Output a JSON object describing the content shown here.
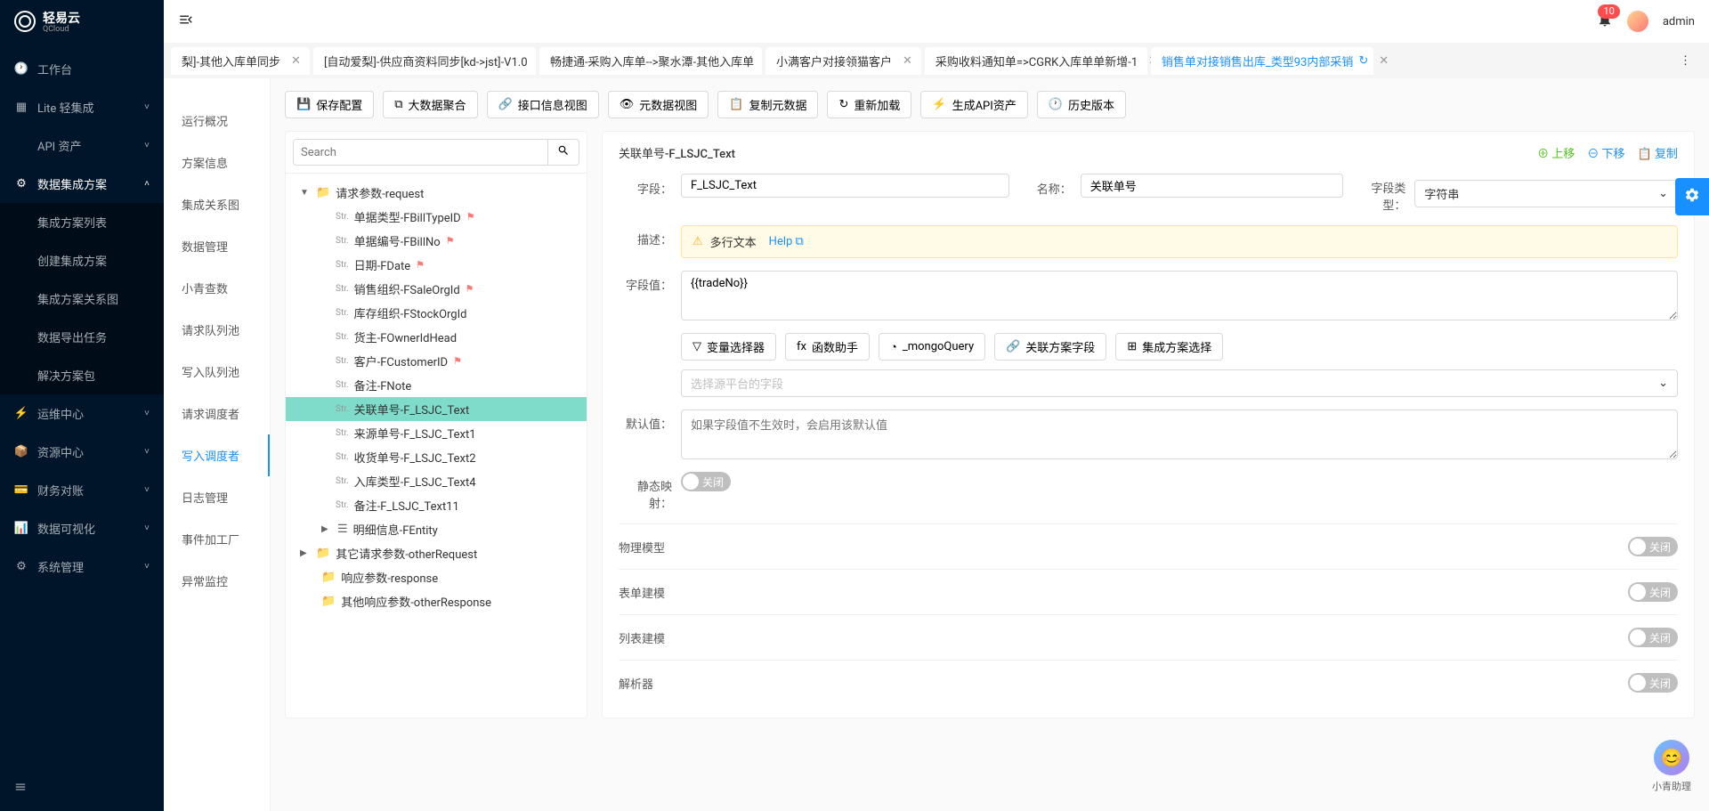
{
  "brand": {
    "name": "轻易云",
    "sub": "QCloud"
  },
  "user": {
    "name": "admin",
    "notifications": "10"
  },
  "nav": {
    "items": [
      {
        "icon": "clock",
        "label": "工作台"
      },
      {
        "icon": "grid",
        "label": "Lite 轻集成",
        "chevron": true
      },
      {
        "icon": "code",
        "label": "API 资产",
        "chevron": true
      },
      {
        "icon": "sitemap",
        "label": "数据集成方案",
        "chevron": true,
        "expanded": true,
        "sub": [
          {
            "label": "集成方案列表"
          },
          {
            "label": "创建集成方案"
          },
          {
            "label": "集成方案关系图"
          },
          {
            "label": "数据导出任务"
          },
          {
            "label": "解决方案包"
          }
        ]
      },
      {
        "icon": "bolt",
        "label": "运维中心",
        "chevron": true
      },
      {
        "icon": "cube",
        "label": "资源中心",
        "chevron": true
      },
      {
        "icon": "wallet",
        "label": "财务对账",
        "chevron": true
      },
      {
        "icon": "chart",
        "label": "数据可视化",
        "chevron": true
      },
      {
        "icon": "gear",
        "label": "系统管理",
        "chevron": true
      }
    ]
  },
  "tabs": [
    {
      "label": "梨]-其他入库单同步"
    },
    {
      "label": "[自动爱梨]-供应商资料同步[kd->jst]-V1.0"
    },
    {
      "label": "畅捷通-采购入库单-->聚水潭-其他入库单"
    },
    {
      "label": "小满客户对接领猫客户"
    },
    {
      "label": "采购收料通知单=>CGRK入库单单新增-1"
    },
    {
      "label": "销售单对接销售出库_类型93内部采销",
      "active": true,
      "refresh": true
    }
  ],
  "midNav": [
    {
      "label": "运行概况"
    },
    {
      "label": "方案信息"
    },
    {
      "label": "集成关系图"
    },
    {
      "label": "数据管理"
    },
    {
      "label": "小青查数"
    },
    {
      "label": "请求队列池"
    },
    {
      "label": "写入队列池"
    },
    {
      "label": "请求调度者"
    },
    {
      "label": "写入调度者",
      "active": true
    },
    {
      "label": "日志管理"
    },
    {
      "label": "事件加工厂"
    },
    {
      "label": "异常监控"
    }
  ],
  "toolbar": [
    {
      "icon": "save",
      "label": "保存配置"
    },
    {
      "icon": "merge",
      "label": "大数据聚合"
    },
    {
      "icon": "link",
      "label": "接口信息视图"
    },
    {
      "icon": "eye",
      "label": "元数据视图"
    },
    {
      "icon": "copy",
      "label": "复制元数据"
    },
    {
      "icon": "reload",
      "label": "重新加载"
    },
    {
      "icon": "api",
      "label": "生成API资产"
    },
    {
      "icon": "history",
      "label": "历史版本"
    }
  ],
  "search": {
    "placeholder": "Search"
  },
  "tree": [
    {
      "level": 0,
      "toggle": "▼",
      "type": "folder",
      "label": "请求参数-request"
    },
    {
      "level": 2,
      "type": "Str.",
      "label": "单据类型-FBillTypeID",
      "flag": true
    },
    {
      "level": 2,
      "type": "Str.",
      "label": "单据编号-FBillNo",
      "flag": true
    },
    {
      "level": 2,
      "type": "Str.",
      "label": "日期-FDate",
      "flag": true
    },
    {
      "level": 2,
      "type": "Str.",
      "label": "销售组织-FSaleOrgId",
      "flag": true
    },
    {
      "level": 2,
      "type": "Str.",
      "label": "库存组织-FStockOrgId"
    },
    {
      "level": 2,
      "type": "Str.",
      "label": "货主-FOwnerIdHead"
    },
    {
      "level": 2,
      "type": "Str.",
      "label": "客户-FCustomerID",
      "flag": true
    },
    {
      "level": 2,
      "type": "Str.",
      "label": "备注-FNote"
    },
    {
      "level": 2,
      "type": "Str.",
      "label": "关联单号-F_LSJC_Text",
      "selected": true
    },
    {
      "level": 2,
      "type": "Str.",
      "label": "来源单号-F_LSJC_Text1"
    },
    {
      "level": 2,
      "type": "Str.",
      "label": "收货单号-F_LSJC_Text2"
    },
    {
      "level": 2,
      "type": "Str.",
      "label": "入库类型-F_LSJC_Text4"
    },
    {
      "level": 2,
      "type": "Str.",
      "label": "备注-F_LSJC_Text11"
    },
    {
      "level": 1,
      "toggle": "▶",
      "type": "list",
      "label": "明细信息-FEntity"
    },
    {
      "level": 0,
      "toggle": "▶",
      "type": "folder",
      "label": "其它请求参数-otherRequest"
    },
    {
      "level": 1,
      "type": "folder",
      "label": "响应参数-response"
    },
    {
      "level": 1,
      "type": "folder",
      "label": "其他响应参数-otherResponse"
    }
  ],
  "detail": {
    "title": "关联单号-F_LSJC_Text",
    "actions": {
      "up": "上移",
      "down": "下移",
      "copy": "复制"
    },
    "labels": {
      "field": "字段：",
      "name": "名称：",
      "fieldType": "字段类型：",
      "desc": "描述：",
      "fieldValue": "字段值：",
      "defaultValue": "默认值：",
      "staticMap": "静态映射："
    },
    "field": "F_LSJC_Text",
    "name": "关联单号",
    "fieldType": "字符串",
    "descText": "多行文本",
    "help": "Help",
    "fieldValue": "{{tradeNo}}",
    "buttons": {
      "varSelector": "变量选择器",
      "funcHelper": "函数助手",
      "mongoQuery": "_mongoQuery",
      "relatedField": "关联方案字段",
      "planSelect": "集成方案选择"
    },
    "platformPlaceholder": "选择源平台的字段",
    "defaultPlaceholder": "如果字段值不生效时，会启用该默认值",
    "toggleOff": "关闭",
    "sections": [
      {
        "label": "物理模型",
        "toggle": "关闭"
      },
      {
        "label": "表单建模",
        "toggle": "关闭"
      },
      {
        "label": "列表建模",
        "toggle": "关闭"
      },
      {
        "label": "解析器",
        "toggle": "关闭"
      }
    ]
  },
  "assistant": {
    "label": "小青助理"
  }
}
